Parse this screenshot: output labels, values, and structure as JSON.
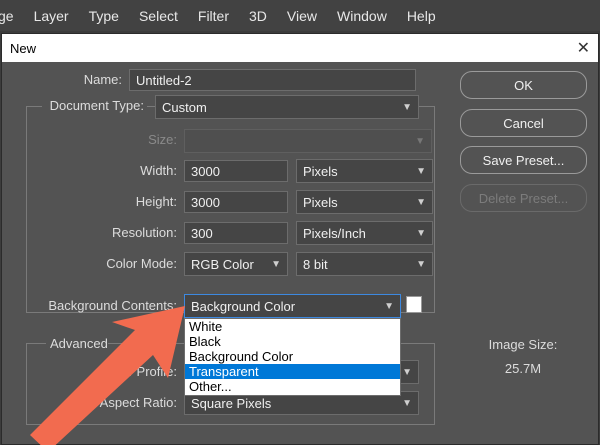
{
  "menubar": {
    "items": [
      "ge",
      "Layer",
      "Type",
      "Select",
      "Filter",
      "3D",
      "View",
      "Window",
      "Help"
    ]
  },
  "dialog": {
    "title": "New",
    "name_label": "Name:",
    "name_value": "Untitled-2",
    "doctype_label": "Document Type:",
    "doctype_value": "Custom",
    "size_label": "Size:",
    "size_value": "",
    "width_label": "Width:",
    "width_value": "3000",
    "width_unit": "Pixels",
    "height_label": "Height:",
    "height_value": "3000",
    "height_unit": "Pixels",
    "resolution_label": "Resolution:",
    "resolution_value": "300",
    "resolution_unit": "Pixels/Inch",
    "colormode_label": "Color Mode:",
    "colormode_value": "RGB Color",
    "bitdepth_value": "8 bit",
    "bgcontents_label": "Background Contents:",
    "bgcontents_value": "Background Color",
    "advanced_label": "Advanced",
    "colorprofile_label": "Color Profile:",
    "pixelaspect_label": "Pixel Aspect Ratio:",
    "pixelaspect_value": "Square Pixels",
    "imagesize_label": "Image Size:",
    "imagesize_value": "25.7M",
    "buttons": {
      "ok": "OK",
      "cancel": "Cancel",
      "save_preset": "Save Preset...",
      "delete_preset": "Delete Preset..."
    },
    "bg_dropdown_options": [
      "White",
      "Black",
      "Background Color",
      "Transparent",
      "Other..."
    ],
    "bg_dropdown_highlighted": "Transparent"
  },
  "colors": {
    "arrow": "#f26b4f",
    "highlight": "#0078d7"
  }
}
